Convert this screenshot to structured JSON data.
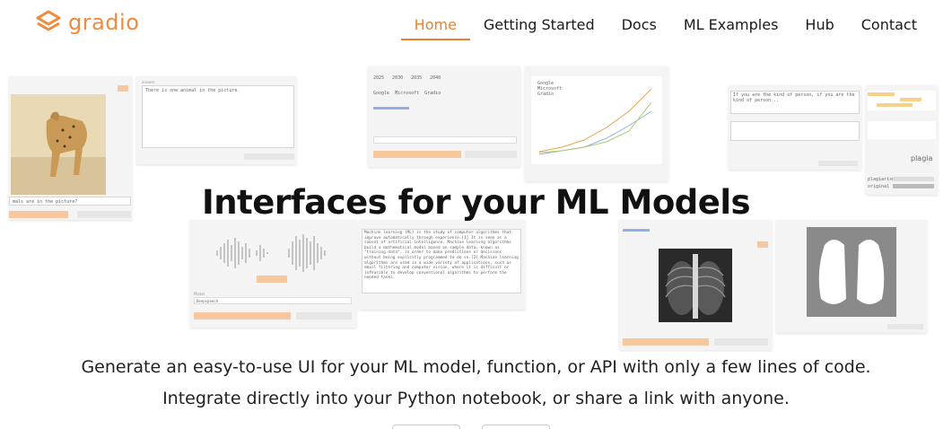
{
  "brand": {
    "name": "gradio",
    "color": "#f08a3c"
  },
  "nav": {
    "items": [
      {
        "label": "Home",
        "active": true
      },
      {
        "label": "Getting Started",
        "active": false
      },
      {
        "label": "Docs",
        "active": false
      },
      {
        "label": "ML Examples",
        "active": false
      },
      {
        "label": "Hub",
        "active": false
      },
      {
        "label": "Contact",
        "active": false
      }
    ]
  },
  "hero": {
    "title": "Interfaces for your ML Models",
    "subtitle": "Generate an easy-to-use UI for your ML model, function, or API with only a few lines of code. Integrate directly into your Python notebook, or share a link with anyone."
  },
  "demos": {
    "image_qa": {
      "answer_text": "There is one animal in the picture.",
      "question_text": "mals are in the picture?"
    },
    "controls": {
      "years": [
        "2025",
        "2030",
        "2035",
        "2040"
      ],
      "checkboxes": [
        "Google",
        "Microsoft",
        "Gradio"
      ]
    },
    "chart": {
      "legend": [
        "Google",
        "Microsoft",
        "Gradio"
      ]
    },
    "text_panels": {
      "input": "If you are the kind of person, if you are the kind of person...",
      "score_label": "plagia",
      "bar_labels": [
        "plagiarism",
        "original"
      ]
    },
    "audio": {
      "model_label": "Model",
      "model_value": "Deepspeech"
    },
    "summary": {
      "text": "Machine learning (ML) is the study of computer algorithms that improve automatically through experience.[1] It is seen as a subset of artificial intelligence. Machine learning algorithms build a mathematical model based on sample data, known as \"training data\", in order to make predictions or decisions without being explicitly programmed to do so.[2] Machine learning algorithms are used in a wide variety of applications, such as email filtering and computer vision, where it is difficult or infeasible to develop conventional algorithms to perform the needed tasks."
    }
  },
  "accent": "#e8822d"
}
